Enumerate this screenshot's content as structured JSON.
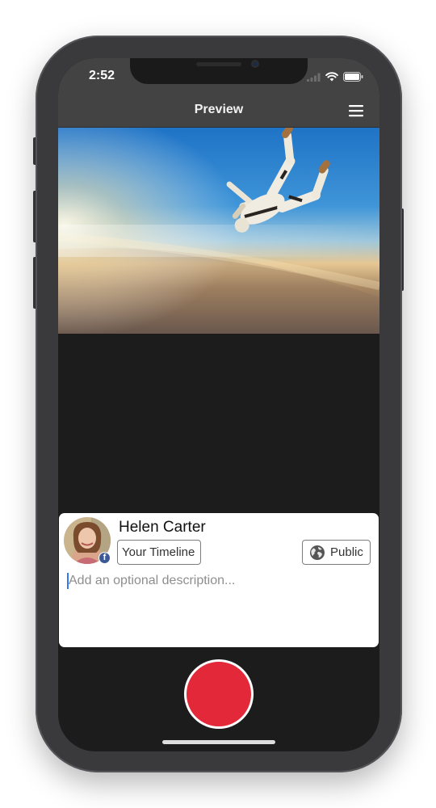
{
  "status_bar": {
    "time": "2:52",
    "icons": [
      "signal-bars-icon",
      "wifi-icon",
      "battery-icon"
    ]
  },
  "nav": {
    "title": "Preview",
    "menu_icon": "hamburger-menu-icon"
  },
  "video": {
    "description": "skydiver-in-freefall-preview"
  },
  "post": {
    "user_name": "Helen Carter",
    "network_badge": "facebook-badge-icon",
    "audience": {
      "destination_label": "Your Timeline",
      "privacy_label": "Public",
      "privacy_icon": "globe-icon"
    },
    "description_placeholder": "Add an optional description..."
  },
  "record": {
    "color": "#e32939"
  },
  "colors": {
    "nav_background": "#434343",
    "screen_background": "#1c1c1c",
    "record_red": "#e32939",
    "facebook_blue": "#3b5998"
  }
}
